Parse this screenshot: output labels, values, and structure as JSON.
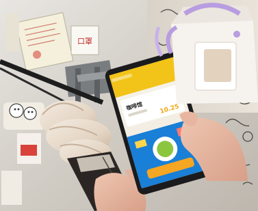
{
  "scene": {
    "description_colors": {
      "ground": "#c9c4bc",
      "phone_body": "#1c1c1e",
      "phone_header": "#f2c319",
      "phone_bottom": "#1a7fd6",
      "ice_cream": "#e9dccd",
      "cone_wrapper": "#2a2522",
      "skin": "#e6b9a4",
      "box": "#f6f2ee",
      "box_accent": "#b89de0"
    }
  },
  "phone": {
    "shop_name": "咖啡馆",
    "amount": "10.25"
  },
  "signs": {
    "sign_2_text": "口罩"
  }
}
